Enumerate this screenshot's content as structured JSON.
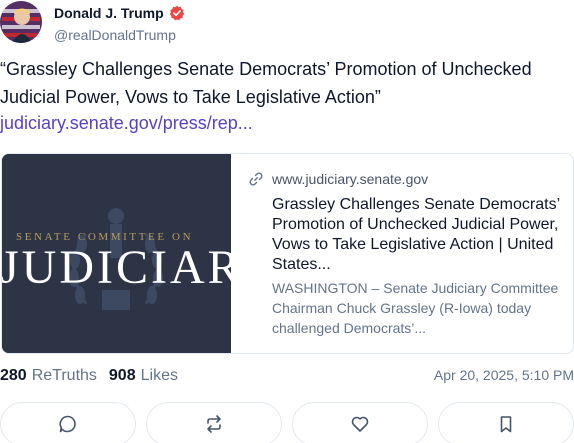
{
  "author": {
    "display_name": "Donald J. Trump",
    "handle": "@realDonaldTrump",
    "verified": true,
    "verified_color": "#ef4444"
  },
  "post": {
    "text": "“Grassley Challenges Senate Democrats’ Promotion of Unchecked Judicial Power, Vows to Take Legislative Action”",
    "link_text": "judiciary.senate.gov/press/rep...",
    "link_color": "#5b3fc4"
  },
  "link_card": {
    "image_text_top": "SENATE COMMITTEE ON",
    "image_text_main": "JUDICIARY",
    "domain": "www.judiciary.senate.gov",
    "title": "Grassley Challenges Senate Democrats’ Promotion of Unchecked Judicial Power, Vows to Take Legislative Action | United States...",
    "description": "WASHINGTON – Senate Judiciary Committee Chairman Chuck Grassley (R-Iowa) today challenged Democrats’..."
  },
  "stats": {
    "retruths_count": "280",
    "retruths_label": "ReTruths",
    "likes_count": "908",
    "likes_label": "Likes",
    "timestamp": "Apr 20, 2025, 5:10 PM"
  },
  "actions": [
    {
      "icon": "comment-icon"
    },
    {
      "icon": "retruth-icon"
    },
    {
      "icon": "heart-icon"
    },
    {
      "icon": "bookmark-icon"
    }
  ]
}
